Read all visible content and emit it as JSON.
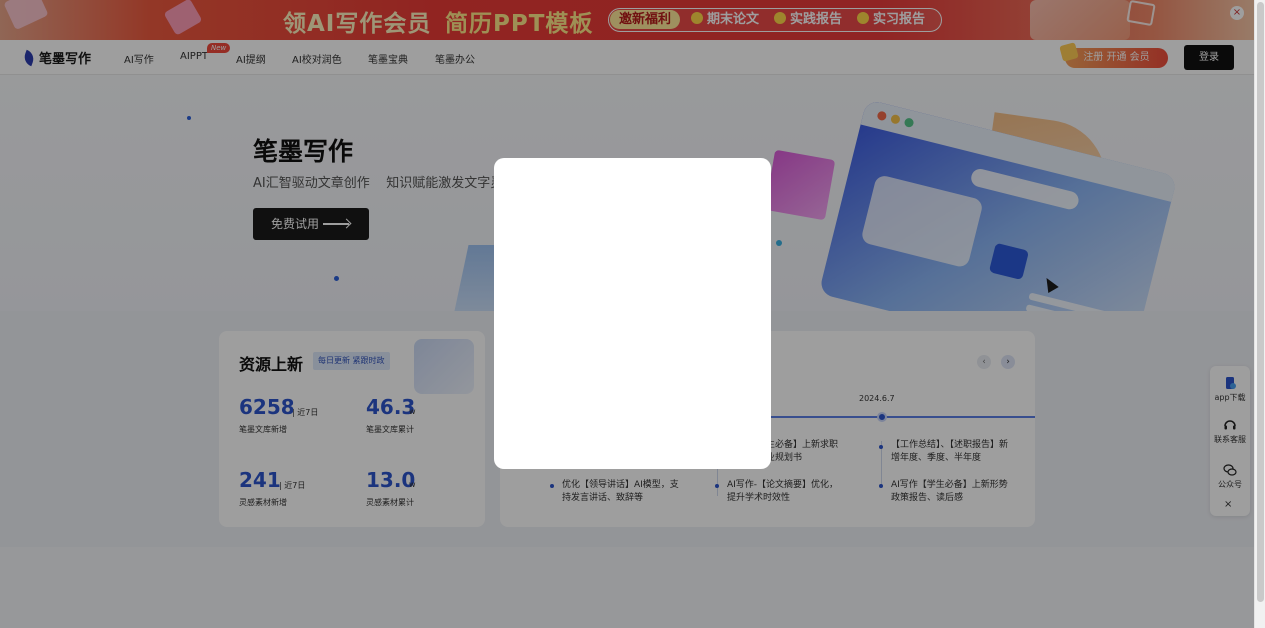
{
  "promo": {
    "title_part1": "领AI写作会员",
    "title_part2": "简历PPT模板",
    "invite": "邀新福利",
    "tags": [
      "期末论文",
      "实践报告",
      "实习报告"
    ],
    "close": "×"
  },
  "header": {
    "logo": "笔墨写作",
    "nav": [
      "AI写作",
      "AIPPT",
      "AI提纲",
      "AI校对润色",
      "笔墨宝典",
      "笔墨办公"
    ],
    "new_badge": "New",
    "register": "注册 开通 会员",
    "login": "登录"
  },
  "hero": {
    "title": "笔墨写作",
    "subtitle": "AI汇智驱动文章创作    知识赋能激发文字灵",
    "cta": "免费试用"
  },
  "resources": {
    "title": "资源上新",
    "badge": "每日更新 紧跟时政",
    "stats": [
      {
        "value": "6258",
        "unit": "| 近7日",
        "label": "笔墨文库新增"
      },
      {
        "value": "46.3",
        "unit": "w",
        "label": "笔墨文库累计"
      },
      {
        "value": "241",
        "unit": "| 近7日",
        "label": "灵感素材新增"
      },
      {
        "value": "13.0",
        "unit": "w",
        "label": "灵感素材累计"
      }
    ]
  },
  "timeline": {
    "date": "2024.6.7",
    "items": [
      {
        "text": "优化【领导讲话】AI模型，支持发言讲话、致辞等"
      },
      {
        "text": "生必备】上新求职业规划书"
      },
      {
        "text": "AI写作-【论文摘要】优化，提升学术时效性"
      },
      {
        "text": "【工作总结】、【述职报告】新增年度、季度、半年度"
      },
      {
        "text": "AI写作【学生必备】上新形势政策报告、读后感"
      }
    ],
    "prev": "‹",
    "next": "›"
  },
  "sidebar": {
    "items": [
      {
        "label": "app下载",
        "icon": "app-download-icon"
      },
      {
        "label": "联系客服",
        "icon": "headset-icon"
      },
      {
        "label": "公众号",
        "icon": "wechat-icon"
      }
    ],
    "close": "×"
  },
  "colors": {
    "accent": "#2d55cc",
    "promo_red": "#ea3a36",
    "dark": "#111111"
  }
}
